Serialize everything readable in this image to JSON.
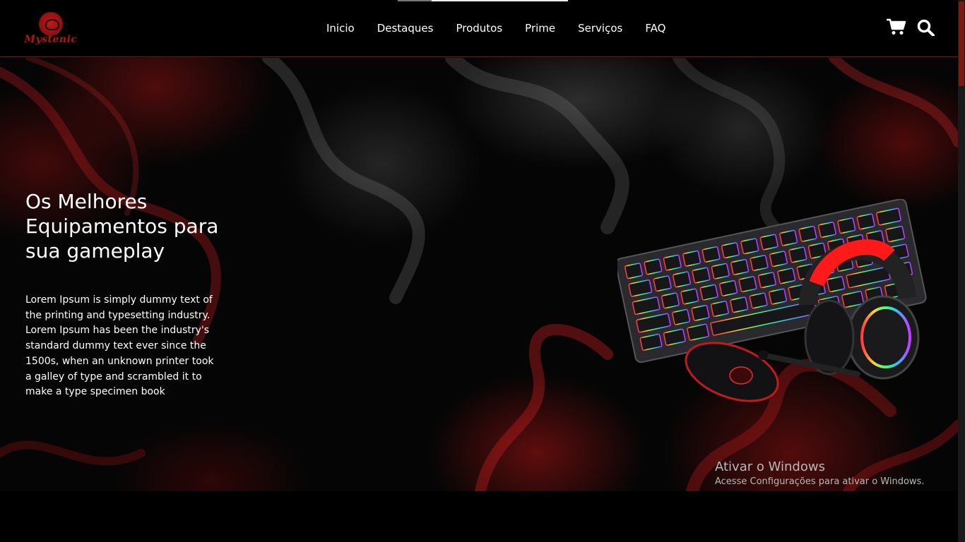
{
  "brand": {
    "logo_text": "Mystenic"
  },
  "nav": {
    "items": [
      {
        "label": "Inicio"
      },
      {
        "label": "Destaques"
      },
      {
        "label": "Produtos"
      },
      {
        "label": "Prime"
      },
      {
        "label": "Serviços"
      },
      {
        "label": "FAQ"
      }
    ]
  },
  "header_icons": {
    "cart": "shopping-cart-icon",
    "search": "search-icon"
  },
  "hero": {
    "title": "Os Melhores Equipamentos para sua gameplay",
    "text": "Lorem Ipsum is simply dummy text of the printing and typesetting industry. Lorem Ipsum has been the industry's standard dummy text ever since the 1500s, when an unknown printer took a galley of type and scrambled it to make a type specimen book",
    "image": "gaming-keyboard-headset-mouse"
  },
  "watermark": {
    "title": "Ativar o Windows",
    "subtitle": "Acesse Configurações para ativar o Windows."
  },
  "colors": {
    "accent": "#b11616",
    "background": "#000000",
    "header_border": "#7a1a12"
  }
}
